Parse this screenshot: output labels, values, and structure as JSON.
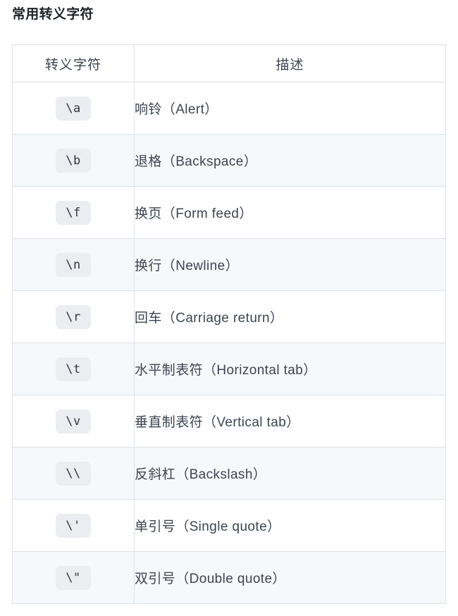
{
  "page": {
    "title": "常用转义字符"
  },
  "table": {
    "headers": {
      "character": "转义字符",
      "description": "描述"
    },
    "rows": [
      {
        "character": "\\a",
        "description": "响铃（Alert）"
      },
      {
        "character": "\\b",
        "description": "退格（Backspace）"
      },
      {
        "character": "\\f",
        "description": "换页（Form feed）"
      },
      {
        "character": "\\n",
        "description": "换行（Newline）"
      },
      {
        "character": "\\r",
        "description": "回车（Carriage return）"
      },
      {
        "character": "\\t",
        "description": "水平制表符（Horizontal tab）"
      },
      {
        "character": "\\v",
        "description": "垂直制表符（Vertical tab）"
      },
      {
        "character": "\\\\",
        "description": "反斜杠（Backslash）"
      },
      {
        "character": "\\'",
        "description": "单引号（Single quote）"
      },
      {
        "character": "\\\"",
        "description": "双引号（Double quote）"
      }
    ]
  },
  "colors": {
    "page_background": "#ffffff",
    "title_text": "#1f2328",
    "table_border": "#dde1e7",
    "row_stripe": "#f7f8fa",
    "row_plain": "#ffffff",
    "badge_background": "#ecedf0",
    "badge_text": "#33383f",
    "body_text": "#3d4450"
  }
}
